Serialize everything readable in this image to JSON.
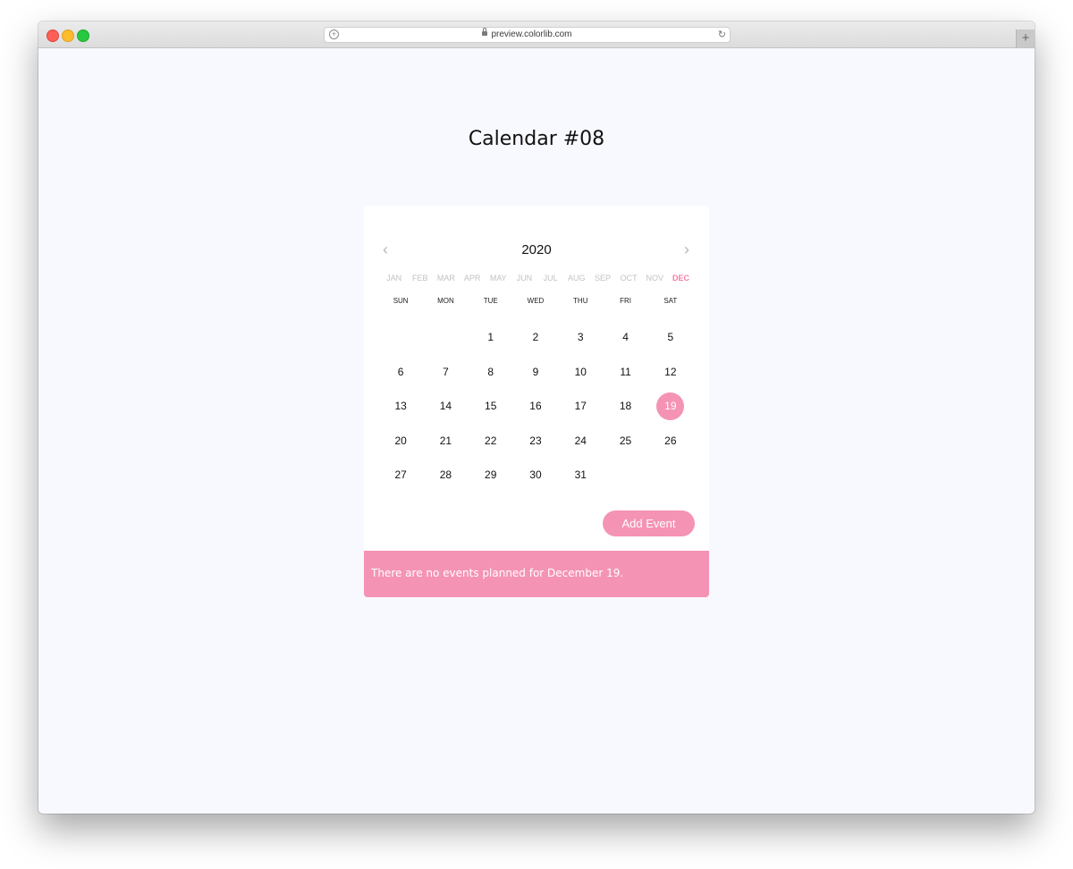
{
  "browser": {
    "url": "preview.colorlib.com",
    "newtab_label": "+",
    "reload_glyph": "↻",
    "addr_icon_glyph": "+"
  },
  "page": {
    "title": "Calendar #08"
  },
  "calendar": {
    "year": "2020",
    "prev_glyph": "‹",
    "next_glyph": "›",
    "months": [
      "JAN",
      "FEB",
      "MAR",
      "APR",
      "MAY",
      "JUN",
      "JUL",
      "AUG",
      "SEP",
      "OCT",
      "NOV",
      "DEC"
    ],
    "active_month_index": 11,
    "weekdays": [
      "SUN",
      "MON",
      "TUE",
      "WED",
      "THU",
      "FRI",
      "SAT"
    ],
    "weeks": [
      [
        "",
        "",
        "1",
        "2",
        "3",
        "4",
        "5"
      ],
      [
        "6",
        "7",
        "8",
        "9",
        "10",
        "11",
        "12"
      ],
      [
        "13",
        "14",
        "15",
        "16",
        "17",
        "18",
        "19"
      ],
      [
        "20",
        "21",
        "22",
        "23",
        "24",
        "25",
        "26"
      ],
      [
        "27",
        "28",
        "29",
        "30",
        "31",
        "",
        ""
      ]
    ],
    "selected_day": "19",
    "add_event_label": "Add Event",
    "events_message": "There are no events planned for December 19.",
    "accent_color": "#f593b4"
  }
}
